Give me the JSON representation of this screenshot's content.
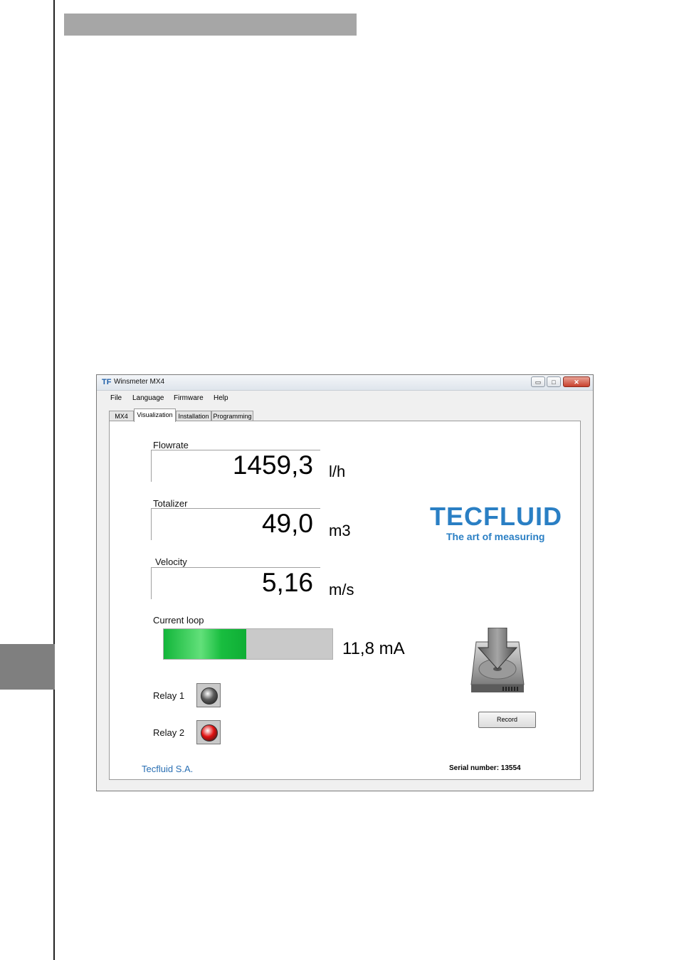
{
  "window": {
    "title": "Winsmeter MX4",
    "controls": {
      "minimize": "▭",
      "maximize": "□",
      "close": "✕"
    }
  },
  "menu": [
    "File",
    "Language",
    "Firmware",
    "Help"
  ],
  "tabs": [
    {
      "label": "MX4",
      "active": false
    },
    {
      "label": "Visualization",
      "active": true
    },
    {
      "label": "Installation",
      "active": false
    },
    {
      "label": "Programming",
      "active": false
    }
  ],
  "readings": {
    "flowrate": {
      "label": "Flowrate",
      "value": "1459,3",
      "unit": "l/h"
    },
    "totalizer": {
      "label": "Totalizer",
      "value": "49,0",
      "unit": "m3"
    },
    "velocity": {
      "label": "Velocity",
      "value": "5,16",
      "unit": "m/s"
    }
  },
  "current_loop": {
    "label": "Current loop",
    "value_text": "11,8 mA",
    "fill_fraction": 0.49,
    "fill_color": "#18bd3f"
  },
  "relays": [
    {
      "label": "Relay 1",
      "state": "off",
      "color": "#5a5a5a"
    },
    {
      "label": "Relay 2",
      "state": "on",
      "color": "#e01010"
    }
  ],
  "logo": {
    "word": "TECFLUID",
    "tagline": "The art of measuring",
    "color": "#2a7fc4"
  },
  "record": {
    "icon": "hard-drive-download-icon",
    "button_label": "Record"
  },
  "footer": {
    "company": "Tecfluid S.A.",
    "serial": "Serial number: 13554"
  }
}
